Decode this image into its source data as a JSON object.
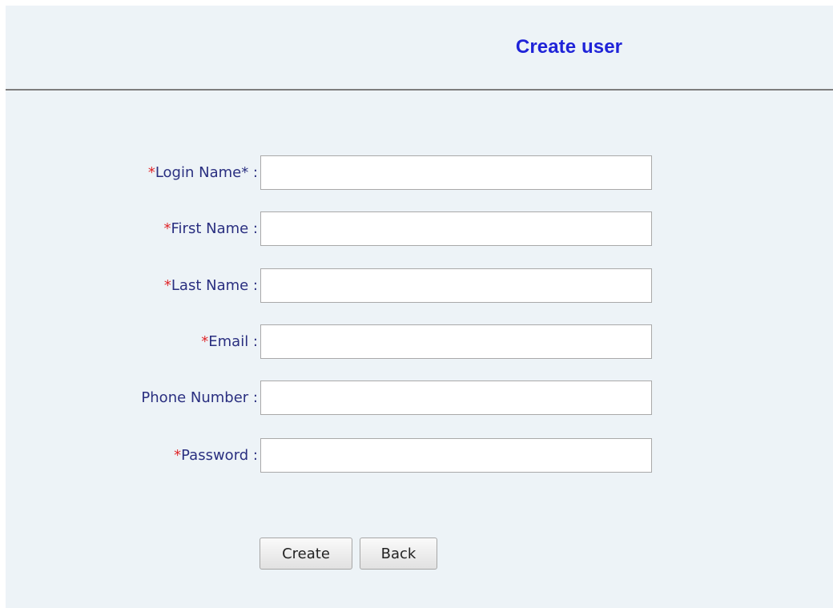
{
  "header": {
    "title": "Create user"
  },
  "form": {
    "fields": [
      {
        "required_mark": "*",
        "label": "Login Name* :",
        "value": "",
        "placeholder": ""
      },
      {
        "required_mark": "*",
        "label": "First Name :",
        "value": "",
        "placeholder": ""
      },
      {
        "required_mark": "*",
        "label": "Last Name :",
        "value": "",
        "placeholder": ""
      },
      {
        "required_mark": "*",
        "label": "Email :",
        "value": "",
        "placeholder": ""
      },
      {
        "required_mark": "",
        "label": "Phone Number :",
        "value": "",
        "placeholder": ""
      },
      {
        "required_mark": "*",
        "label": "Password :",
        "value": "",
        "placeholder": ""
      }
    ]
  },
  "buttons": {
    "create_label": "Create",
    "back_label": "Back"
  },
  "colors": {
    "title": "#1f23d8",
    "label": "#2a2f80",
    "required": "#e0262a",
    "panel_background": "#edf3f7"
  }
}
